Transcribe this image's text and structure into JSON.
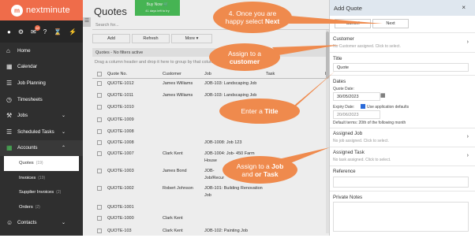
{
  "logo": {
    "mark": "m",
    "text": "nextminute"
  },
  "topicons": {
    "badge_mail": "18",
    "badge_bell": "?"
  },
  "nav": {
    "home": "Home",
    "calendar": "Calendar",
    "job_planning": "Job Planning",
    "timesheets": "Timesheets",
    "jobs": "Jobs",
    "scheduled_tasks": "Scheduled Tasks",
    "accounts": "Accounts",
    "quotes": "Quotes",
    "quotes_count": "(19)",
    "invoices": "Invoices",
    "invoices_count": "(19)",
    "supplier_invoices": "Supplier Invoices",
    "supplier_invoices_count": "(2)",
    "orders": "Orders",
    "orders_count": "(2)",
    "contacts": "Contacts"
  },
  "main": {
    "title": "Quotes",
    "buy_now": "Buy Now",
    "buy_now_sub": "41 days left to try",
    "search_placeholder": "Search for...",
    "add": "Add",
    "refresh": "Refresh",
    "more": "More",
    "filter_bar": "Quotes - No filters active",
    "drag_hint": "Drag a column header and drop it here to group by that column",
    "columns": [
      "Quote No.",
      "Customer",
      "Job",
      "Task",
      "R"
    ],
    "rows": [
      {
        "no": "QUOTE-1012",
        "customer": "James Williams",
        "job": "JOB-103: Landscaping Job",
        "job2": ""
      },
      {
        "no": "QUOTE-1011",
        "customer": "James Williams",
        "job": "JOB-103: Landscaping Job",
        "job2": ""
      },
      {
        "no": "QUOTE-1010",
        "customer": "",
        "job": "",
        "job2": ""
      },
      {
        "no": "QUOTE-1009",
        "customer": "",
        "job": "",
        "job2": ""
      },
      {
        "no": "QUOTE-1008",
        "customer": "",
        "job": "",
        "job2": ""
      },
      {
        "no": "QUOTE-1008",
        "customer": "",
        "job": "JOB-1008: Job 123",
        "job2": ""
      },
      {
        "no": "QUOTE-1007",
        "customer": "Clark Kent",
        "job": "JOB-1004: Job- 450 Farm",
        "job2": "House"
      },
      {
        "no": "QUOTE-1003",
        "customer": "James Bond",
        "job": "JOB-",
        "job2": "Job/Recur"
      },
      {
        "no": "QUOTE-1002",
        "customer": "Robert Johnson",
        "job": "JOB-101: Building Renovation",
        "job2": "Job"
      },
      {
        "no": "QUOTE-1001",
        "customer": "",
        "job": "",
        "job2": ""
      },
      {
        "no": "QUOTE-1000",
        "customer": "Clark Kent",
        "job": "",
        "job2": ""
      },
      {
        "no": "QUOTE-103",
        "customer": "Clark Kent",
        "job": "JOB-102: Painting Job",
        "job2": ""
      }
    ]
  },
  "panel": {
    "title": "Add Quote",
    "close": "×",
    "cancel": "Cancel",
    "next": "Next",
    "customer_label": "Customer",
    "customer_value": "No Customer assigned. Click to select.",
    "title_label": "Title",
    "title_value": "Quote",
    "dates_label": "Dates",
    "quote_date_label": "Quote Date:",
    "quote_date_value": "30/05/2023",
    "expiry_label": "Expiry Date:",
    "use_defaults": "Use application defaults",
    "expiry_value": "20/06/2023",
    "default_terms": "Default terms: 20th of the following month",
    "assigned_job_label": "Assigned Job",
    "assigned_job_value": "No job assigned. Click to select.",
    "assigned_task_label": "Assigned Task",
    "assigned_task_value": "No task assigned. Click to select.",
    "reference_label": "Reference",
    "private_notes_label": "Private Notes"
  },
  "callouts": {
    "c1_line1": "4. Once you are",
    "c1_line2": "happy select",
    "c1_bold": "Next",
    "c2_line1": "Assign to a",
    "c2_bold": "customer",
    "c3_line1": "Enter a",
    "c3_bold": "Title",
    "c4_line1": "Assign to a",
    "c4_bold1": "Job",
    "c4_line2": "and",
    "c4_or": "or",
    "c4_bold2": "Task"
  },
  "colors": {
    "brand": "#ef6c4a",
    "callout": "#ef8a4d",
    "sidebar": "#2f2f2f",
    "buy_now": "#4cc25a"
  }
}
